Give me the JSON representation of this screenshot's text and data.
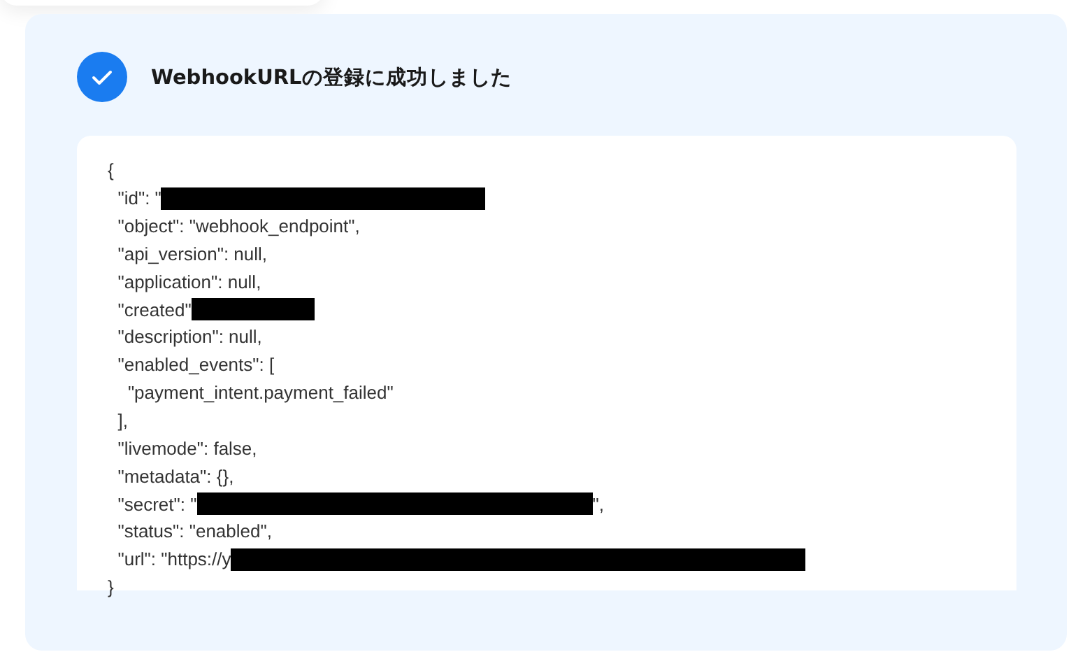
{
  "result": {
    "title": "WebhookURLの登録に成功しました",
    "success": true,
    "lines": [
      {
        "parts": [
          {
            "kind": "text",
            "text": "{"
          }
        ]
      },
      {
        "parts": [
          {
            "kind": "text",
            "text": "  \"id\": \""
          },
          {
            "kind": "redaction"
          }
        ]
      },
      {
        "parts": [
          {
            "kind": "text",
            "text": "  \"object\": \"webhook_endpoint\","
          }
        ]
      },
      {
        "parts": [
          {
            "kind": "text",
            "text": "  \"api_version\": null,"
          }
        ]
      },
      {
        "parts": [
          {
            "kind": "text",
            "text": "  \"application\": null,"
          }
        ]
      },
      {
        "parts": [
          {
            "kind": "text",
            "text": "  \"created\""
          },
          {
            "kind": "redaction"
          }
        ]
      },
      {
        "parts": [
          {
            "kind": "text",
            "text": "  \"description\": null,"
          }
        ]
      },
      {
        "parts": [
          {
            "kind": "text",
            "text": "  \"enabled_events\": ["
          }
        ]
      },
      {
        "parts": [
          {
            "kind": "text",
            "text": "    \"payment_intent.payment_failed\""
          }
        ]
      },
      {
        "parts": [
          {
            "kind": "text",
            "text": "  ],"
          }
        ]
      },
      {
        "parts": [
          {
            "kind": "text",
            "text": "  \"livemode\": false,"
          }
        ]
      },
      {
        "parts": [
          {
            "kind": "text",
            "text": "  \"metadata\": {},"
          }
        ]
      },
      {
        "parts": [
          {
            "kind": "text",
            "text": "  \"secret\": \""
          },
          {
            "kind": "redaction"
          },
          {
            "kind": "text",
            "text": "\","
          }
        ]
      },
      {
        "parts": [
          {
            "kind": "text",
            "text": "  \"status\": \"enabled\","
          }
        ]
      },
      {
        "parts": [
          {
            "kind": "text",
            "text": "  \"url\": \"https://y"
          },
          {
            "kind": "redaction"
          }
        ]
      },
      {
        "parts": [
          {
            "kind": "text",
            "text": "}"
          }
        ]
      }
    ]
  }
}
